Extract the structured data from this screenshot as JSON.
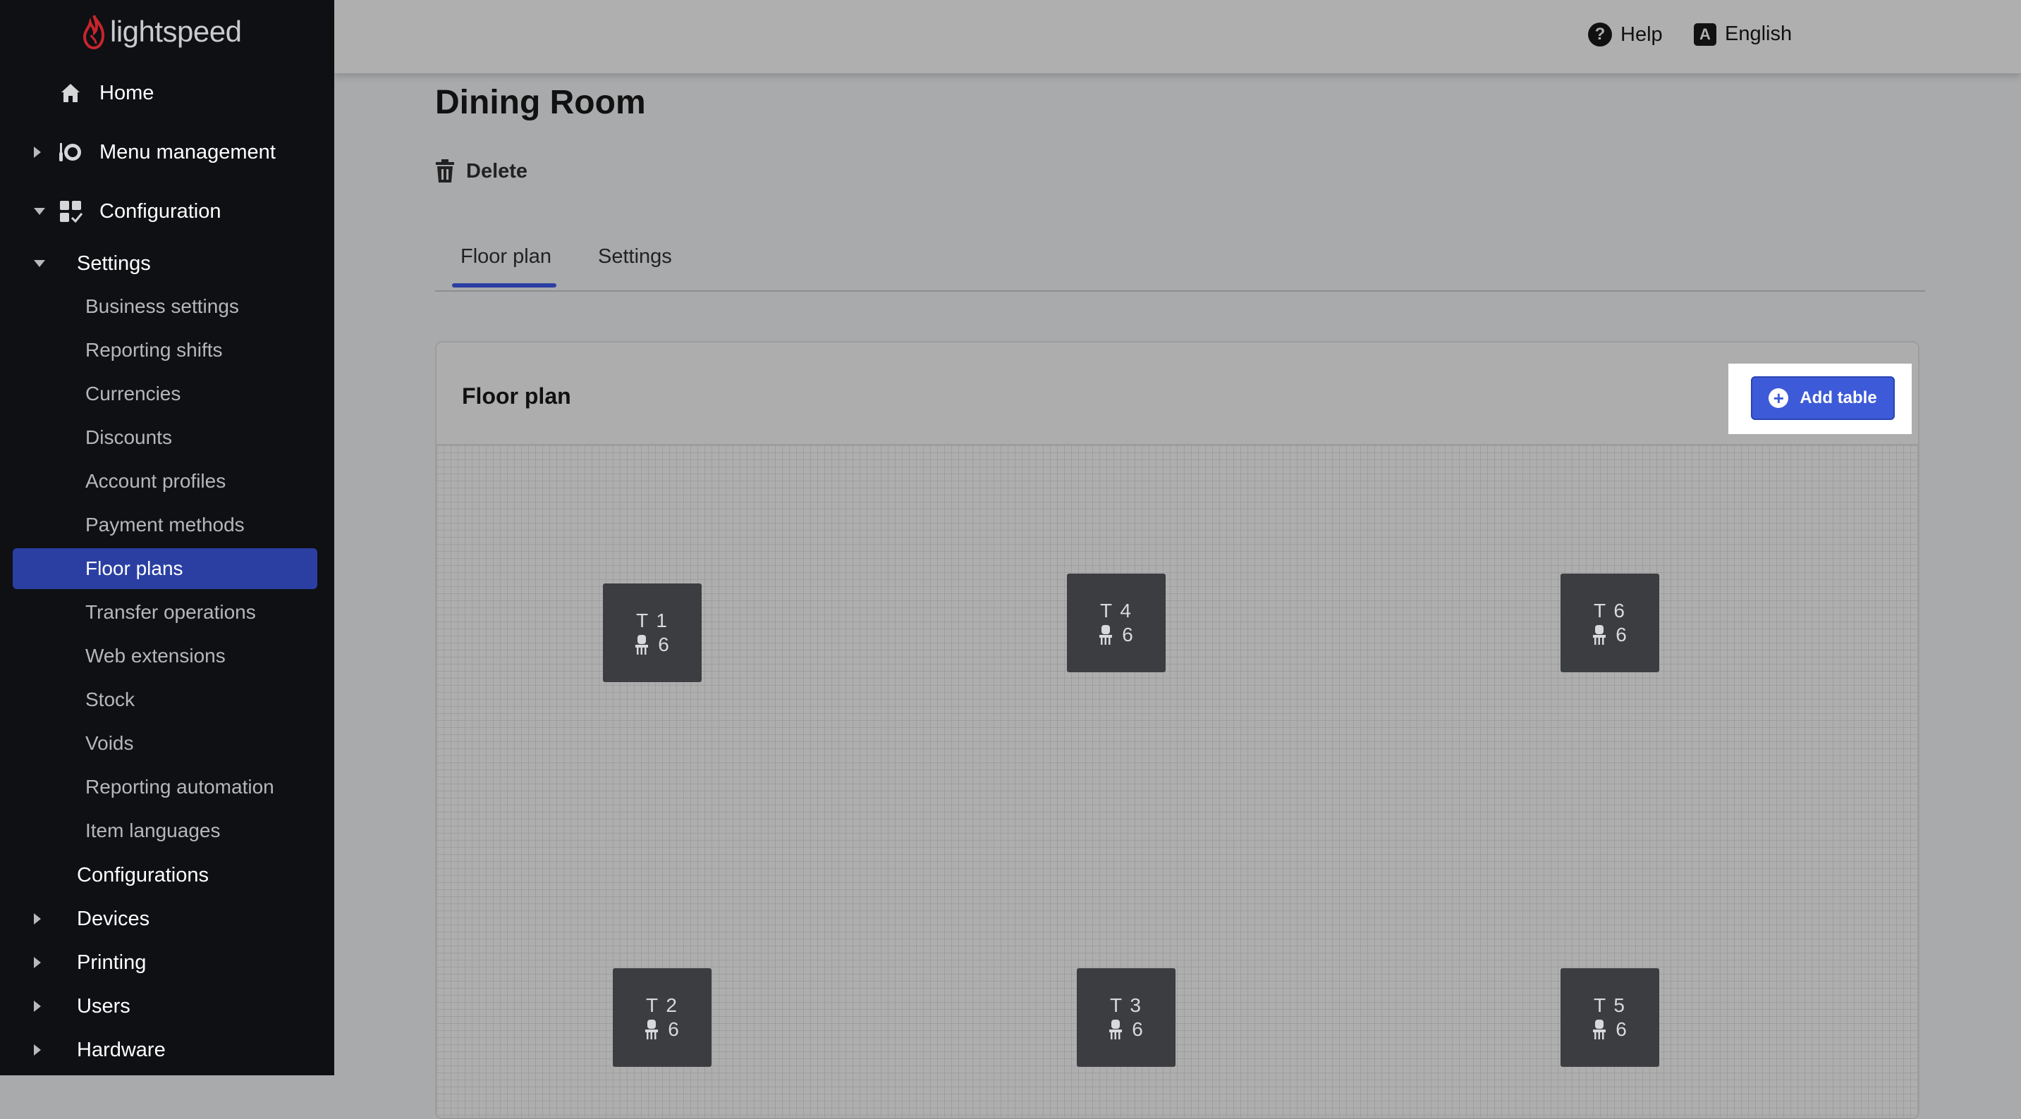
{
  "brand": {
    "name": "lightspeed"
  },
  "topbar": {
    "help_label": "Help",
    "language_label": "English",
    "language_icon_letter": "A"
  },
  "sidebar": {
    "items": [
      {
        "label": "Home",
        "icon": "home-icon"
      },
      {
        "label": "Menu management",
        "icon": "menu-icon"
      },
      {
        "label": "Configuration",
        "icon": "configuration-icon"
      }
    ],
    "settings_label": "Settings",
    "settings_children": [
      "Business settings",
      "Reporting shifts",
      "Currencies",
      "Discounts",
      "Account profiles",
      "Payment methods",
      "Floor plans",
      "Transfer operations",
      "Web extensions",
      "Stock",
      "Voids",
      "Reporting automation",
      "Item languages"
    ],
    "active_item": "Floor plans",
    "configurations_label": "Configurations",
    "sections": [
      "Devices",
      "Printing",
      "Users",
      "Hardware"
    ]
  },
  "main": {
    "title": "Dining Room",
    "delete_label": "Delete",
    "tabs": [
      {
        "label": "Floor plan"
      },
      {
        "label": "Settings"
      }
    ],
    "active_tab": "Floor plan"
  },
  "floor_plan": {
    "title": "Floor plan",
    "add_table_label": "Add table",
    "tables": [
      {
        "name": "T 1",
        "seats": "6"
      },
      {
        "name": "T 4",
        "seats": "6"
      },
      {
        "name": "T 6",
        "seats": "6"
      },
      {
        "name": "T 2",
        "seats": "6"
      },
      {
        "name": "T 3",
        "seats": "6"
      },
      {
        "name": "T 5",
        "seats": "6"
      }
    ]
  },
  "colors": {
    "accent": "#2b3fa3",
    "button": "#3d5bd8",
    "sidebar_bg": "#0e1013",
    "table_bg": "#3b3d40"
  }
}
